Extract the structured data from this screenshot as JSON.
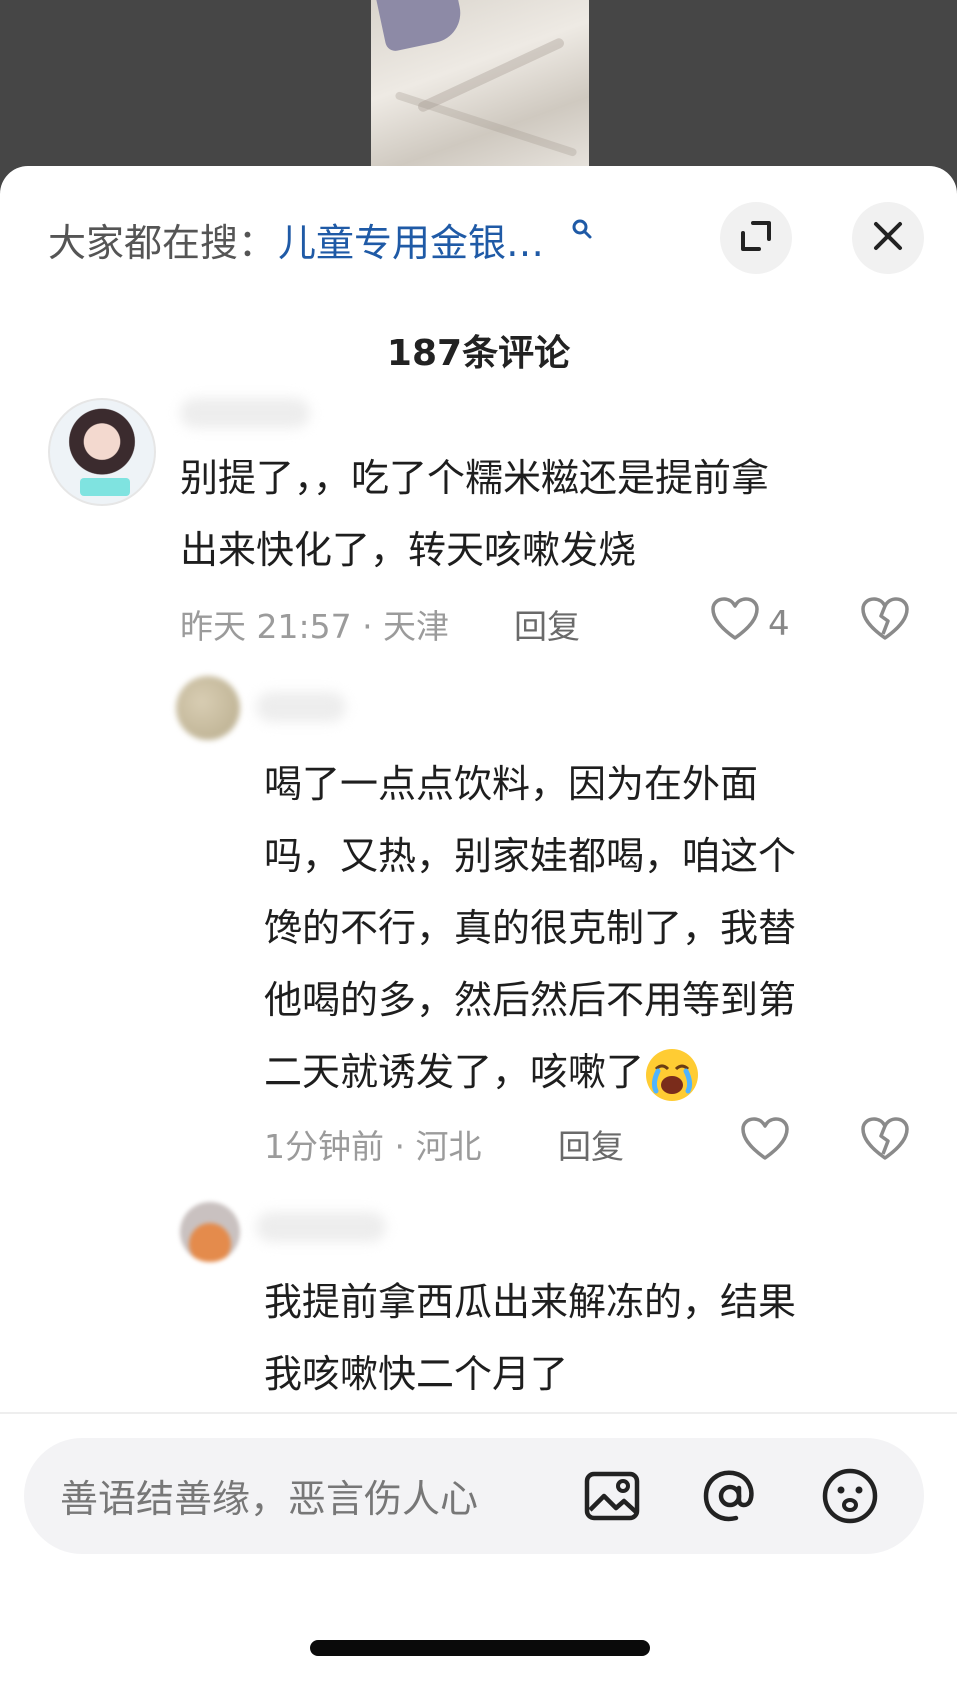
{
  "header": {
    "search_prefix": "大家都在搜：",
    "search_query": "儿童专用金银…",
    "comment_count": "187条评论"
  },
  "comments": [
    {
      "text": "别提了，，吃了个糯米糍还是提前拿\n出来快化了，转天咳嗽发烧",
      "time_location": "昨天 21:57 · 天津",
      "reply_label": "回复",
      "likes": "4"
    },
    {
      "text": "喝了一点点饮料，因为在外面\n吗，又热，别家娃都喝，咱这个\n馋的不行，真的很克制了，我替\n他喝的多，然后然后不用等到第\n二天就诱发了，咳嗽了",
      "time_location": "1分钟前 · 河北",
      "reply_label": "回复",
      "likes": ""
    },
    {
      "text": "我提前拿西瓜出来解冻的，结果\n我咳嗽快二个月了"
    }
  ],
  "input": {
    "placeholder": "善语结善缘，恶言伤人心"
  },
  "icons": {
    "search": "search-icon",
    "expand": "expand-icon",
    "close": "close-icon",
    "like": "heart-icon",
    "dislike": "broken-heart-icon",
    "image": "image-icon",
    "mention": "at-icon",
    "emoji": "smiley-icon",
    "crying_emoji": "crying-laugh-emoji"
  }
}
